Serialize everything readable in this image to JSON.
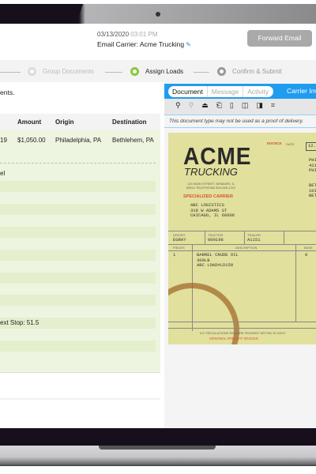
{
  "header": {
    "date": "03/13/2020",
    "time": "03:01 PM",
    "carrier_label": "Email Carrier: Acme Trucking",
    "forward_button": "Forward Email"
  },
  "steps": [
    {
      "label": "Group Documents",
      "state": "done"
    },
    {
      "label": "Assign Loads",
      "state": "active"
    },
    {
      "label": "Confirm & Submit",
      "state": "pending"
    }
  ],
  "colors": {
    "accent_blue": "#1e9cf0",
    "active_step": "#8cc63f",
    "row_green": "#edf5e0"
  },
  "left": {
    "intro": "ents.",
    "columns": [
      "Amount",
      "Origin",
      "Destination"
    ],
    "row": {
      "id_fragment": "19",
      "amount": "$1,050.00",
      "origin": "Philadelphia, PA",
      "destination": "Bethlehem, PA"
    },
    "label_top": "el",
    "label_next_stop": "ext Stop: 51.5"
  },
  "right": {
    "tabs": [
      "Document",
      "Message",
      "Activity"
    ],
    "carrier_tab": "Carrier Inv",
    "tools": [
      "zoom-in-icon",
      "zoom-out-icon",
      "stamp-icon",
      "rotate-left-icon",
      "rotate-right-icon",
      "split-icon",
      "merge-icon",
      "crop-icon"
    ],
    "notice": "This document type may not be used as a proof of delivery.",
    "document": {
      "logo": "ACME",
      "logo_sub": "TRUCKING",
      "address": "123 MAIN STREET, BISMARK, IL 60814  TELEPHONE 800-555-1212",
      "invoice_label": "INVOICE",
      "date_label": "DATE",
      "date_value": "12.",
      "specialized": "SPECIALIZED CARRIER",
      "bill_to": "ABC LOGISTICS\n318 W ADAMS ST\nCHICAGO, IL 60606",
      "side1": "PHI\n421\nPHI",
      "side2": "BET\n101\nBET",
      "driver_label": "DRIVER",
      "driver": "EGRAY",
      "tractor_label": "TRACTOR",
      "tractor": "000198",
      "trailer_label": "TRAILER",
      "trailer": "A1151",
      "pieces_label": "PIECES",
      "pieces": "1",
      "desc_label": "DESCRIPTION",
      "desc": "BARREL CRUDE OIL\n300LB\nABC LOAD#LD150",
      "base_label": "BASE",
      "base": "0",
      "footer": "ICC REGULATIONS REQUIRE PAYMENT WITHIN 15 DAYS",
      "footer2": "ORIGINAL FREIGHT INVOICE"
    }
  }
}
